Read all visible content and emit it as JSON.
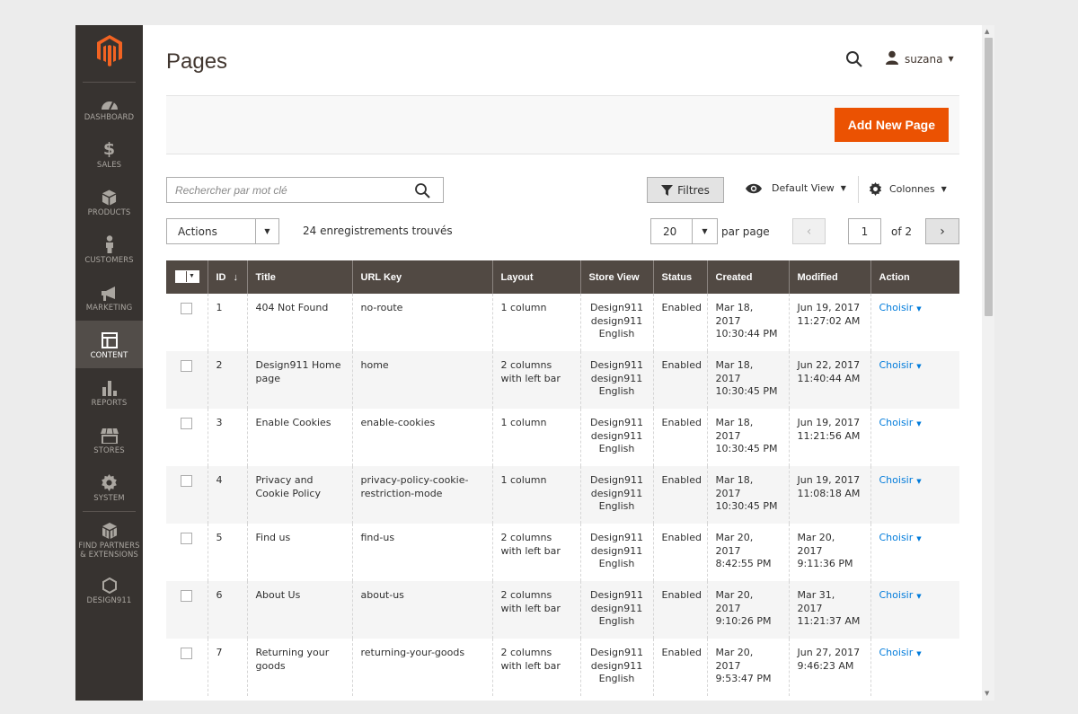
{
  "sidebar": {
    "logo": "magento-logo",
    "items": [
      {
        "label": "DASHBOARD",
        "icon": "dashboard-icon"
      },
      {
        "label": "SALES",
        "icon": "dollar-icon"
      },
      {
        "label": "PRODUCTS",
        "icon": "box-icon"
      },
      {
        "label": "CUSTOMERS",
        "icon": "person-icon"
      },
      {
        "label": "MARKETING",
        "icon": "megaphone-icon"
      },
      {
        "label": "CONTENT",
        "icon": "layout-icon",
        "active": true
      },
      {
        "label": "REPORTS",
        "icon": "bar-chart-icon"
      },
      {
        "label": "STORES",
        "icon": "storefront-icon"
      },
      {
        "label": "SYSTEM",
        "icon": "gear-icon"
      },
      {
        "label": "FIND PARTNERS & EXTENSIONS",
        "icon": "cubes-icon"
      },
      {
        "label": "DESIGN911",
        "icon": "hexagon-icon"
      }
    ]
  },
  "header": {
    "title": "Pages",
    "user": "suzana"
  },
  "toolbar": {
    "add_label": "Add New Page",
    "accent": "#eb5202"
  },
  "search": {
    "placeholder": "Rechercher par mot clé"
  },
  "controls": {
    "filters": "Filtres",
    "default_view": "Default View",
    "columns": "Colonnes",
    "actions": "Actions",
    "records": "24 enregistrements trouvés",
    "per_page_value": "20",
    "per_page_label": "par page",
    "page": "1",
    "of_pages": "of 2"
  },
  "grid": {
    "columns": [
      "",
      "ID",
      "Title",
      "URL Key",
      "Layout",
      "Store View",
      "Status",
      "Created",
      "Modified",
      "Action"
    ],
    "rows": [
      {
        "id": "1",
        "title": "404 Not Found",
        "url_key": "no-route",
        "layout": "1 column",
        "store_view": [
          "Design911",
          "design911",
          "English"
        ],
        "status": "Enabled",
        "created": [
          "Mar 18, 2017",
          "10:30:44 PM"
        ],
        "modified": [
          "Jun 19, 2017",
          "11:27:02 AM"
        ],
        "action": "Choisir"
      },
      {
        "id": "2",
        "title": "Design911 Home page",
        "url_key": "home",
        "layout": "2 columns with left bar",
        "store_view": [
          "Design911",
          "design911",
          "English"
        ],
        "status": "Enabled",
        "created": [
          "Mar 18, 2017",
          "10:30:45 PM"
        ],
        "modified": [
          "Jun 22, 2017",
          "11:40:44 AM"
        ],
        "action": "Choisir"
      },
      {
        "id": "3",
        "title": "Enable Cookies",
        "url_key": "enable-cookies",
        "layout": "1 column",
        "store_view": [
          "Design911",
          "design911",
          "English"
        ],
        "status": "Enabled",
        "created": [
          "Mar 18, 2017",
          "10:30:45 PM"
        ],
        "modified": [
          "Jun 19, 2017",
          "11:21:56 AM"
        ],
        "action": "Choisir"
      },
      {
        "id": "4",
        "title": "Privacy and Cookie Policy",
        "url_key": "privacy-policy-cookie-restriction-mode",
        "layout": "1 column",
        "store_view": [
          "Design911",
          "design911",
          "English"
        ],
        "status": "Enabled",
        "created": [
          "Mar 18, 2017",
          "10:30:45 PM"
        ],
        "modified": [
          "Jun 19, 2017",
          "11:08:18 AM"
        ],
        "action": "Choisir"
      },
      {
        "id": "5",
        "title": "Find us",
        "url_key": "find-us",
        "layout": "2 columns with left bar",
        "store_view": [
          "Design911",
          "design911",
          "English"
        ],
        "status": "Enabled",
        "created": [
          "Mar 20, 2017",
          "8:42:55 PM"
        ],
        "modified": [
          "Mar 20, 2017",
          "9:11:36 PM"
        ],
        "action": "Choisir"
      },
      {
        "id": "6",
        "title": "About Us",
        "url_key": "about-us",
        "layout": "2 columns with left bar",
        "store_view": [
          "Design911",
          "design911",
          "English"
        ],
        "status": "Enabled",
        "created": [
          "Mar 20, 2017",
          "9:10:26 PM"
        ],
        "modified": [
          "Mar 31, 2017",
          "11:21:37 AM"
        ],
        "action": "Choisir"
      },
      {
        "id": "7",
        "title": "Returning your goods",
        "url_key": "returning-your-goods",
        "layout": "2 columns with left bar",
        "store_view": [
          "Design911",
          "design911",
          "English"
        ],
        "status": "Enabled",
        "created": [
          "Mar 20, 2017",
          "9:53:47 PM"
        ],
        "modified": [
          "Jun 27, 2017",
          "9:46:23 AM"
        ],
        "action": "Choisir"
      }
    ]
  }
}
